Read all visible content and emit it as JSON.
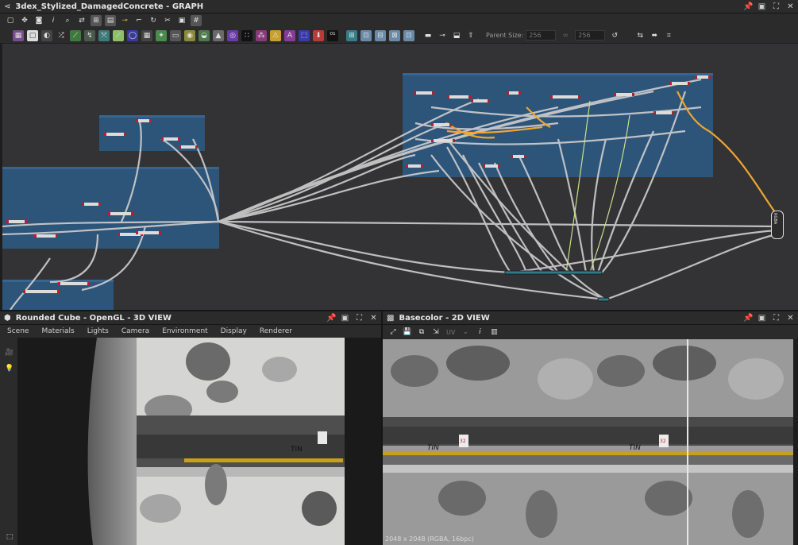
{
  "graph": {
    "title": "3dex_Stylized_DamagedConcrete - GRAPH",
    "parent_size_label": "Parent Size:",
    "parent_size_value": "256",
    "size_value": "256",
    "output_node_label": "RGBA"
  },
  "view3d": {
    "title": "Rounded Cube - OpenGL - 3D VIEW",
    "menus": [
      "Scene",
      "Materials",
      "Lights",
      "Camera",
      "Environment",
      "Display",
      "Renderer"
    ]
  },
  "view2d": {
    "title": "Basecolor - 2D VIEW",
    "channel_label": "UV",
    "status": "2048 x 2048 (RGBA, 16bpc)",
    "sign_text": "TIN",
    "sticker_number": "32"
  },
  "colors": {
    "panel_bg": "#2b2b2b",
    "canvas_bg": "#333335",
    "frame_blue": "#2c5a86",
    "link_gray": "#cfcfcf",
    "link_orange": "#f0a530",
    "node_red": "#b8202a"
  }
}
